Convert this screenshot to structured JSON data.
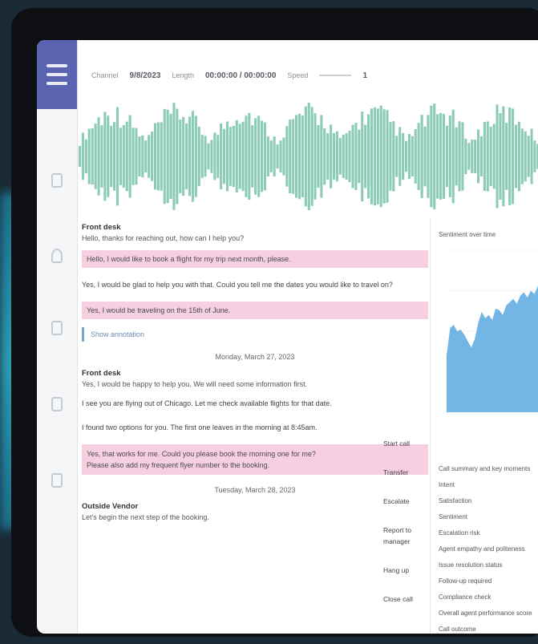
{
  "header": {
    "channel_label": "Channel",
    "channel_value": "9/8/2023",
    "length_label": "Length",
    "length_value": "00:00:00 / 00:00:00",
    "speed_label": "Speed",
    "speed_value": "1"
  },
  "transcript": {
    "speaker1": "Front desk",
    "line1": "Hello, thanks for reaching out, how can I help you?",
    "hl1": "Hello, I would like to book a flight for my trip next month, please.",
    "plain1": "Yes, I would be glad to help you with that. Could you tell me the dates you would like to travel on?",
    "hl2": "Yes, I would be traveling on the 15th of June.",
    "quote": "Show annotation",
    "date1": "Monday, March 27, 2023",
    "speaker2": "Front desk",
    "line2": "Yes, I would be happy to help you. We will need some information first.",
    "line3": "I see you are flying out of Chicago. Let me check available flights for that date.",
    "line4": "I found two options for you. The first one leaves in the morning at 8:45am.",
    "hl3a": "Yes, that works for me. Could you please book the morning one for me?",
    "hl3b": "Please also add my frequent flyer number to the booking.",
    "date2": "Tuesday, March 28, 2023",
    "speaker3": "Outside Vendor",
    "line5": "Let's begin the next step of the booking."
  },
  "mid_col": [
    "Start call",
    "Transfer",
    "Escalate",
    "Report to manager",
    "Hang up",
    "Close call"
  ],
  "side": {
    "title": "Sentiment over time",
    "list": [
      "Call summary and key moments",
      "Intent",
      "Satisfaction",
      "Sentiment",
      "Escalation risk",
      "Agent empathy and politeness",
      "Issue resolution status",
      "Follow-up required",
      "Compliance check",
      "Overall agent performance score",
      "Call outcome"
    ]
  },
  "chart_data": {
    "type": "area",
    "x": [
      0,
      1,
      2,
      3,
      4,
      5,
      6,
      7,
      8,
      9,
      10,
      11,
      12,
      13,
      14,
      15,
      16,
      17,
      18,
      19,
      20,
      21,
      22,
      23,
      24,
      25,
      26,
      27,
      28,
      29
    ],
    "values": [
      35,
      52,
      54,
      50,
      51,
      48,
      44,
      40,
      45,
      55,
      62,
      58,
      60,
      57,
      64,
      63,
      60,
      66,
      68,
      70,
      67,
      72,
      74,
      71,
      75,
      73,
      78,
      76,
      74,
      72
    ],
    "ylim": [
      0,
      100
    ],
    "color": "#5aa8e0"
  },
  "colors": {
    "accent": "#5a63b0",
    "waveform": "#8ccbb8",
    "highlight": "#f6cfe0",
    "chart_fill": "#5aa8e0"
  }
}
